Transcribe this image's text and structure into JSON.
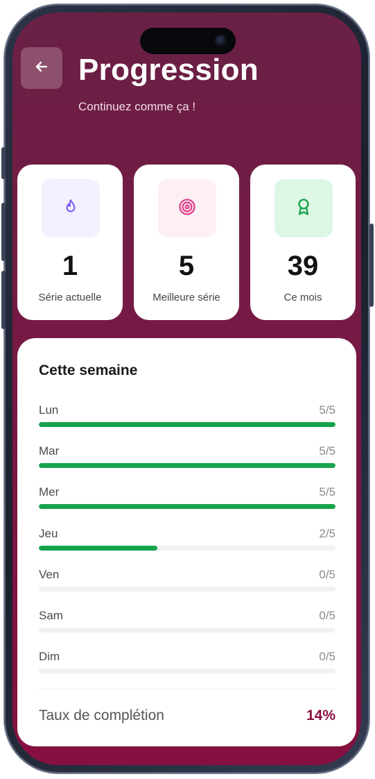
{
  "header": {
    "title": "Progression",
    "subtitle": "Continuez comme ça !"
  },
  "stats": [
    {
      "value": "1",
      "label": "Série actuelle",
      "icon": "flame-icon",
      "icon_color": "#7c5cf0",
      "icon_bg": "#f3f0ff"
    },
    {
      "value": "5",
      "label": "Meilleure série",
      "icon": "target-icon",
      "icon_color": "#e0408a",
      "icon_bg": "#fdf0f5"
    },
    {
      "value": "39",
      "label": "Ce mois",
      "icon": "award-icon",
      "icon_color": "#16a34a",
      "icon_bg": "#ddf7e4"
    }
  ],
  "week": {
    "title": "Cette semaine",
    "days": [
      {
        "name": "Lun",
        "count": "5/5",
        "progress": 1.0
      },
      {
        "name": "Mar",
        "count": "5/5",
        "progress": 1.0
      },
      {
        "name": "Mer",
        "count": "5/5",
        "progress": 1.0
      },
      {
        "name": "Jeu",
        "count": "2/5",
        "progress": 0.4
      },
      {
        "name": "Ven",
        "count": "0/5",
        "progress": 0.0
      },
      {
        "name": "Sam",
        "count": "0/5",
        "progress": 0.0
      },
      {
        "name": "Dim",
        "count": "0/5",
        "progress": 0.0
      }
    ],
    "completion_label": "Taux de complétion",
    "completion_value": "14%"
  },
  "colors": {
    "accent": "#8a1040",
    "progress": "#16a34a"
  }
}
